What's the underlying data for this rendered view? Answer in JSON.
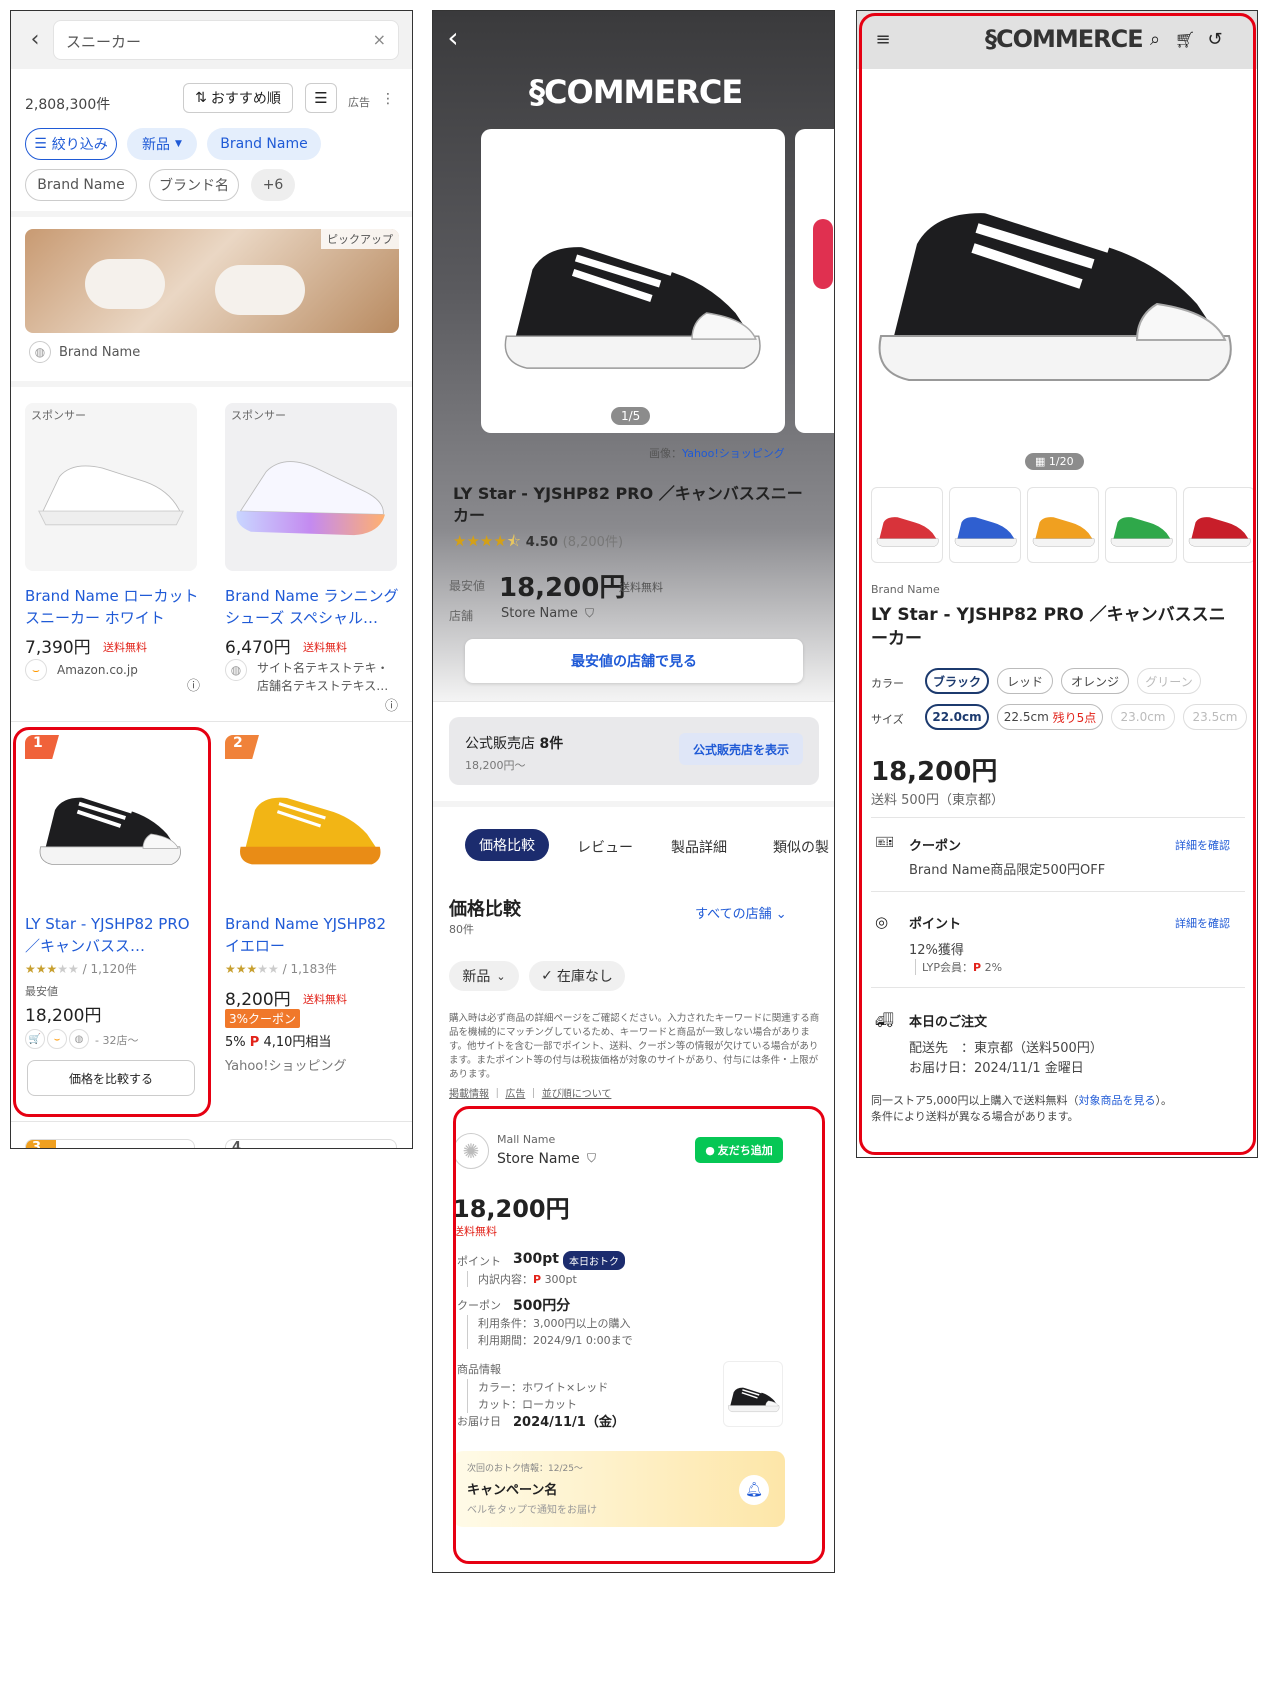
{
  "search": {
    "query": "スニーカー",
    "result_count": "2,808,300件",
    "sort_label": "おすすめ順",
    "ad_label": "広告",
    "filters": [
      "絞り込み",
      "新品",
      "Brand Name"
    ],
    "filters2": [
      "Brand Name",
      "ブランド名",
      "+6"
    ],
    "pickup_label": "ピックアップ",
    "pickup_brand": "Brand Name",
    "sponsored": [
      {
        "badge": "スポンサー",
        "title": "Brand Name ローカット スニーカー ホワイト",
        "price": "7,390円",
        "shipping": "送料無料",
        "store": "Amazon.co.jp"
      },
      {
        "badge": "スポンサー",
        "title": "Brand Name ランニングシューズ スペシャル…",
        "price": "6,470円",
        "shipping": "送料無料",
        "store": "サイト名テキストテキ・店舗名テキストテキス…"
      }
    ],
    "ranked": [
      {
        "rank": "1",
        "title": "LY Star - YJSHP82 PRO ／キャンバスス…",
        "rating": 2.5,
        "reviews": "/ 1,120件",
        "min_label": "最安値",
        "price": "18,200円",
        "stores": "- 32店〜",
        "compare_button": "価格を比較する"
      },
      {
        "rank": "2",
        "title": "Brand Name YJSHP82 イエロー",
        "rating": 2.5,
        "reviews": "/ 1,183件",
        "price": "8,200円",
        "shipping": "送料無料",
        "coupon": "3%クーポン",
        "points_rate": "5%",
        "points": "4,10円相当",
        "store": "Yahoo!ショッピング"
      }
    ],
    "next_ranks": [
      "3",
      "4"
    ]
  },
  "compare": {
    "logo": "COMMERCE",
    "image_counter": "1/5",
    "image_credit_prefix": "画像：",
    "image_credit": "Yahoo!ショッピング",
    "title": "LY Star - YJSHP82 PRO ／キャンバススニーカー",
    "rating": 4.5,
    "rating_value": "4.50",
    "rating_count": "(8,200件)",
    "min_label": "最安値",
    "price": "18,200円",
    "shipping": "送料無料",
    "store_label": "店舗",
    "store_name": "Store Name",
    "lowest_button": "最安値の店舗で見る",
    "official_label": "公式販売店",
    "official_count": "8件",
    "official_price": "18,200円〜",
    "official_button": "公式販売店を表示",
    "tabs": [
      "価格比較",
      "レビュー",
      "製品詳細",
      "類似の製"
    ],
    "section_title": "価格比較",
    "section_count": "80件",
    "all_stores": "すべての店舗",
    "filter_new": "新品",
    "filter_stock": "在庫なし",
    "disclaimer": "購入時は必ず商品の詳細ページをご確認ください。入力されたキーワードに関連する商品を機械的にマッチングしているため、キーワードと商品が一致しない場合があります。他サイトを含む一部でポイント、送料、クーポン等の情報が欠けている場合があります。またポイント等の付与は税抜価格が対象のサイトがあり、付与には条件・上限があります。",
    "links": [
      "掲載情報",
      "広告",
      "並び順について"
    ],
    "offer": {
      "mall": "Mall Name",
      "store": "Store Name",
      "line_button": "友だち追加",
      "price": "18,200円",
      "shipping": "送料無料",
      "points_label": "ポイント",
      "points": "300pt",
      "points_badge": "本日おトク",
      "points_detail_label": "内訳内容：",
      "points_detail": "300pt",
      "coupon_label": "クーポン",
      "coupon": "500円分",
      "coupon_cond": "利用条件：3,000円以上の購入",
      "coupon_period": "利用期間：2024/9/1 0:00まで",
      "info_label": "商品情報",
      "info_color": "カラー：ホワイト×レッド",
      "info_cut": "カット：ローカット",
      "delivery_label": "お届け日",
      "delivery": "2024/11/1（金）",
      "campaign_next": "次回のおトク情報：12/25〜",
      "campaign_name": "キャンペーン名",
      "campaign_hint": "ベルをタップで通知をお届け"
    }
  },
  "detail": {
    "logo": "COMMERCE",
    "image_counter": "1/20",
    "thumb_colors": [
      "#d8333a",
      "#2f5fd0",
      "#f0a020",
      "#2fa84a",
      "#c81e2a"
    ],
    "brand": "Brand Name",
    "title": "LY Star - YJSHP82 PRO ／キャンバススニーカー",
    "color_label": "カラー",
    "colors": [
      "ブラック",
      "レッド",
      "オレンジ",
      "グリーン"
    ],
    "size_label": "サイズ",
    "sizes": [
      "22.0cm",
      "22.5cm",
      "23.0cm",
      "23.5cm"
    ],
    "size_remaining": "残り5点",
    "price": "18,200円",
    "shipping": "送料 500円（東京都）",
    "coupon_label": "クーポン",
    "coupon_link": "詳細を確認",
    "coupon_text": "Brand Name商品限定500円OFF",
    "point_label": "ポイント",
    "point_link": "詳細を確認",
    "point_text": "12%獲得",
    "point_sub_label": "LYP会員：",
    "point_sub": "2%",
    "order_label": "本日のご注文",
    "order_dest": "配送先　：東京都（送料500円）",
    "order_date": "お届け日：2024/11/1 金曜日",
    "note_prefix": "同一ストア5,000円以上購入で送料無料（",
    "note_link": "対象商品を見る",
    "note_suffix": "）。",
    "note2": "条件により送料が異なる場合があります。"
  },
  "colors": {
    "accent": "#1f5ad6",
    "red": "#e2231a",
    "highlight": "#e60012",
    "navy": "#1c3a6e",
    "line_green": "#06c755"
  }
}
